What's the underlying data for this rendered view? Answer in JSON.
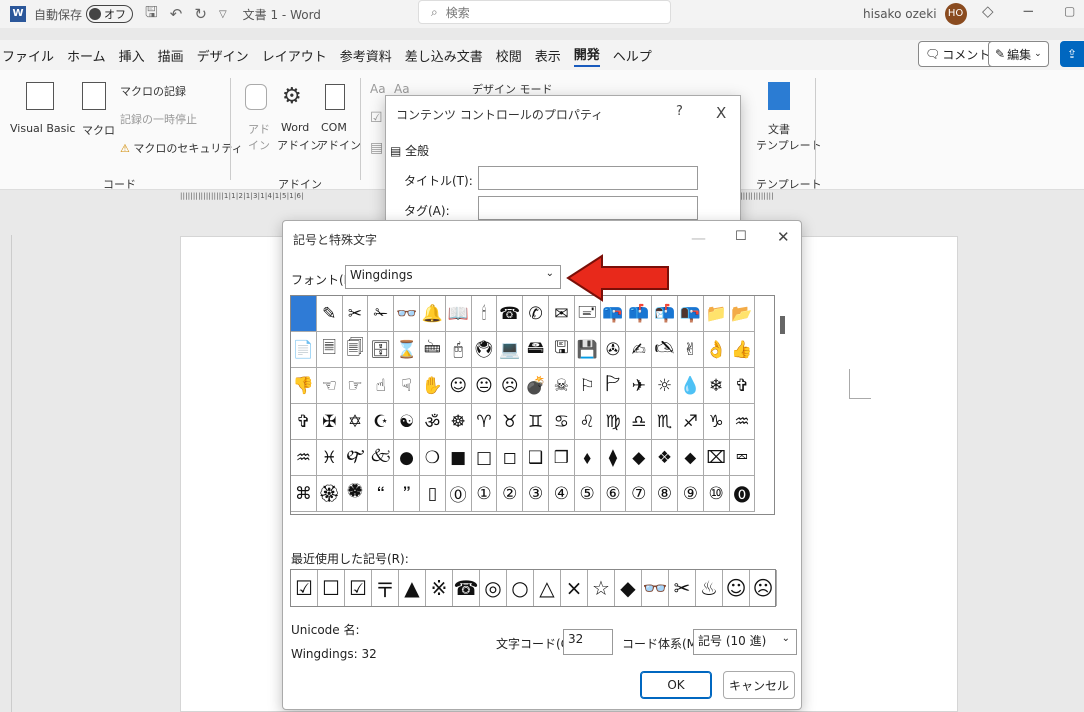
{
  "titlebar": {
    "autosave": "自動保存",
    "toggle": "オフ",
    "doc_title": "文書 1 - Word",
    "search_placeholder": "検索",
    "user": "hisako ozeki",
    "initials": "HO"
  },
  "menu": {
    "items": [
      "ファイル",
      "ホーム",
      "挿入",
      "描画",
      "デザイン",
      "レイアウト",
      "参考資料",
      "差し込み文書",
      "校閲",
      "表示",
      "開発",
      "ヘルプ"
    ],
    "active": "開発",
    "comment": "コメント",
    "edit": "編集"
  },
  "ribbon": {
    "code": {
      "visual_basic": "Visual Basic",
      "macro": "マクロ",
      "record": "マクロの記録",
      "pause": "記録の一時停止",
      "security": "マクロのセキュリティ",
      "group": "コード"
    },
    "addin": {
      "addin1": "アド",
      "addin2": "イン",
      "word1": "Word",
      "word2": "アドイン",
      "com1": "COM",
      "com2": "アドイン",
      "group": "アドイン"
    },
    "controls": {
      "design_mode": "デザイン モード",
      "aa1": "Aa",
      "aa2": "Aa"
    },
    "template": {
      "label1": "文書",
      "label2": "テンプレート",
      "group": "テンプレート"
    }
  },
  "ruler": {
    "left": "| | | | | | | | | | | | | | | | | 1 | 1 | 2 | 1 | 3 | 1 | 4 | 1 | 5 | 1 | 6 |",
    "right": "| 32 | 33 | 34 | 35 | 36 | 37 | 38 | | | | | | | | | | | | | |"
  },
  "cc_dialog": {
    "title": "コンテンツ コントロールのプロパティ",
    "help": "?",
    "close": "X",
    "section": "全般",
    "title_label": "タイトル(T):",
    "tag_label": "タグ(A):"
  },
  "sym_dialog": {
    "title": "記号と特殊文字",
    "font_label": "フォント(F):",
    "font_value": "Wingdings",
    "recent_label": "最近使用した記号(R):",
    "unicode_label": "Unicode 名:",
    "unicode_value": "Wingdings: 32",
    "code_label": "文字コード(C):",
    "code_value": "32",
    "codeset_label": "コード体系(M):",
    "codeset_value": "記号 (10 進)",
    "ok": "OK",
    "cancel": "キャンセル",
    "symbols": [
      " ",
      "✎",
      "✂",
      "✁",
      "👓",
      "🔔",
      "📖",
      "🕯",
      "☎",
      "✆",
      "✉",
      "🖃",
      "📪",
      "📫",
      "📬",
      "📭",
      "📁",
      "📂",
      "📄",
      "🗏",
      "🗐",
      "🗄",
      "⌛",
      "🖮",
      "🖰",
      "🖲",
      "💻",
      "🖴",
      "🖫",
      "💾",
      "✇",
      "✍",
      "🖎",
      "✌",
      "👌",
      "👍",
      "👎",
      "☜",
      "☞",
      "☝",
      "☟",
      "✋",
      "☺",
      "😐",
      "☹",
      "💣",
      "☠",
      "⚐",
      "🏱",
      "✈",
      "☼",
      "💧",
      "❄",
      "✞",
      "✞",
      "✠",
      "✡",
      "☪",
      "☯",
      "ॐ",
      "☸",
      "♈",
      "♉",
      "♊",
      "♋",
      "♌",
      "♍",
      "♎",
      "♏",
      "♐",
      "♑",
      "♒",
      "♒",
      "♓",
      "🙰",
      "🙵",
      "●",
      "❍",
      "■",
      "□",
      "◻",
      "❑",
      "❒",
      "⬧",
      "⧫",
      "◆",
      "❖",
      "⬥",
      "⌧",
      "⮹",
      "⌘",
      "🏵",
      "🏶",
      "🙶",
      "🙷",
      "▯",
      "⓪",
      "①",
      "②",
      "③",
      "④",
      "⑤",
      "⑥",
      "⑦",
      "⑧",
      "⑨",
      "⑩",
      "⓿"
    ],
    "recent": [
      "☑",
      "☐",
      "☑",
      "〒",
      "▲",
      "※",
      "☎",
      "◎",
      "○",
      "△",
      "×",
      "☆",
      "◆",
      "👓",
      "✂",
      "♨",
      "☺",
      "☹"
    ]
  }
}
